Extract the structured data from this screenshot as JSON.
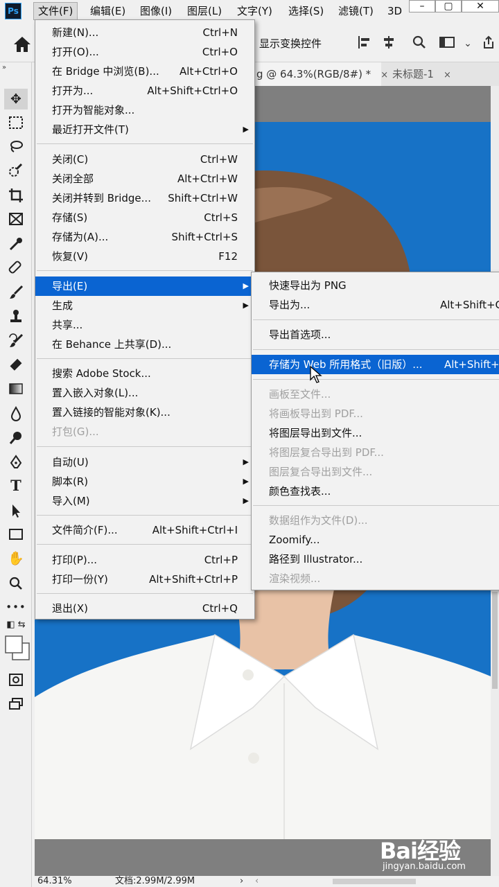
{
  "menubar": {
    "app_icon": "Ps",
    "items": [
      "文件(F)",
      "编辑(E)",
      "图像(I)",
      "图层(L)",
      "文字(Y)",
      "选择(S)",
      "滤镜(T)",
      "3D"
    ],
    "window_buttons": [
      "–",
      "▢",
      "✕"
    ]
  },
  "options": {
    "transform_label": "显示变换控件",
    "icons": [
      "align-left-icon",
      "align-center-icon",
      "search-icon",
      "workspace-icon",
      "chevron-down-icon",
      "share-icon"
    ]
  },
  "tabs": [
    {
      "label": "g @ 64.3%(RGB/8#) *",
      "close": "×",
      "active": true
    },
    {
      "label": "未标题-1",
      "close": "×",
      "active": false
    }
  ],
  "file_menu": {
    "items": [
      {
        "label": "新建(N)...",
        "shortcut": "Ctrl+N"
      },
      {
        "label": "打开(O)...",
        "shortcut": "Ctrl+O"
      },
      {
        "label": "在 Bridge 中浏览(B)...",
        "shortcut": "Alt+Ctrl+O"
      },
      {
        "label": "打开为...",
        "shortcut": "Alt+Shift+Ctrl+O"
      },
      {
        "label": "打开为智能对象...",
        "shortcut": ""
      },
      {
        "label": "最近打开文件(T)",
        "shortcut": "",
        "submenu": true
      },
      {
        "label": "关闭(C)",
        "shortcut": "Ctrl+W"
      },
      {
        "label": "关闭全部",
        "shortcut": "Alt+Ctrl+W"
      },
      {
        "label": "关闭并转到 Bridge...",
        "shortcut": "Shift+Ctrl+W"
      },
      {
        "label": "存储(S)",
        "shortcut": "Ctrl+S"
      },
      {
        "label": "存储为(A)...",
        "shortcut": "Shift+Ctrl+S"
      },
      {
        "label": "恢复(V)",
        "shortcut": "F12"
      },
      {
        "label": "导出(E)",
        "shortcut": "",
        "submenu": true,
        "highlighted": true
      },
      {
        "label": "生成",
        "shortcut": "",
        "submenu": true
      },
      {
        "label": "共享...",
        "shortcut": ""
      },
      {
        "label": "在 Behance 上共享(D)...",
        "shortcut": ""
      },
      {
        "label": "搜索 Adobe Stock...",
        "shortcut": ""
      },
      {
        "label": "置入嵌入对象(L)...",
        "shortcut": ""
      },
      {
        "label": "置入链接的智能对象(K)...",
        "shortcut": ""
      },
      {
        "label": "打包(G)...",
        "shortcut": "",
        "disabled": true
      },
      {
        "label": "自动(U)",
        "shortcut": "",
        "submenu": true
      },
      {
        "label": "脚本(R)",
        "shortcut": "",
        "submenu": true
      },
      {
        "label": "导入(M)",
        "shortcut": "",
        "submenu": true
      },
      {
        "label": "文件简介(F)...",
        "shortcut": "Alt+Shift+Ctrl+I"
      },
      {
        "label": "打印(P)...",
        "shortcut": "Ctrl+P"
      },
      {
        "label": "打印一份(Y)",
        "shortcut": "Alt+Shift+Ctrl+P"
      },
      {
        "label": "退出(X)",
        "shortcut": "Ctrl+Q"
      }
    ]
  },
  "export_menu": {
    "items": [
      {
        "label": "快速导出为 PNG",
        "shortcut": ""
      },
      {
        "label": "导出为...",
        "shortcut": "Alt+Shift+C"
      },
      {
        "label": "导出首选项...",
        "shortcut": ""
      },
      {
        "label": "存储为 Web 所用格式（旧版）...",
        "shortcut": "Alt+Shift+",
        "highlighted": true
      },
      {
        "label": "画板至文件...",
        "shortcut": "",
        "disabled": true
      },
      {
        "label": "将画板导出到 PDF...",
        "shortcut": "",
        "disabled": true
      },
      {
        "label": "将图层导出到文件...",
        "shortcut": ""
      },
      {
        "label": "将图层复合导出到 PDF...",
        "shortcut": "",
        "disabled": true
      },
      {
        "label": "图层复合导出到文件...",
        "shortcut": "",
        "disabled": true
      },
      {
        "label": "颜色查找表...",
        "shortcut": ""
      },
      {
        "label": "数据组作为文件(D)...",
        "shortcut": "",
        "disabled": true
      },
      {
        "label": "Zoomify...",
        "shortcut": ""
      },
      {
        "label": "路径到 Illustrator...",
        "shortcut": ""
      },
      {
        "label": "渲染视频...",
        "shortcut": "",
        "disabled": true
      }
    ]
  },
  "status": {
    "zoom": "64.31%",
    "doc_size": "文档:2.99M/2.99M",
    "arrow": "›",
    "scroll_left": "‹"
  },
  "watermark": {
    "logo": "Bai经验",
    "url": "jingyan.baidu.com"
  },
  "colors": {
    "accent": "#0a64d2",
    "photo_background": "#1772c6"
  }
}
